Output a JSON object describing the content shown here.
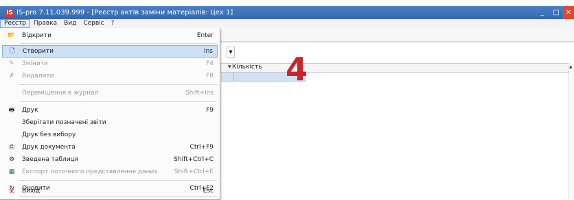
{
  "window": {
    "logo_letter": "IS",
    "title": "IS-pro 7.11.039.999 - [Реєстр актів заміни матеріалів: Цех 1]",
    "minimize": "_",
    "maximize": "□"
  },
  "menubar": [
    "Реєстр",
    "Правка",
    "Вид",
    "Сервіс",
    "?"
  ],
  "menu": {
    "items": [
      {
        "label": "Відкрити",
        "shortcut": "Enter"
      },
      {
        "label": "Створити",
        "shortcut": "Ins"
      },
      {
        "label": "Змінити",
        "shortcut": "F4"
      },
      {
        "label": "Видалити",
        "shortcut": "F8"
      },
      {
        "label": "Переміщення в журнал",
        "shortcut": "Shift+Ins"
      },
      {
        "label": "Друк",
        "shortcut": "F9"
      },
      {
        "label": "Зберігати позначені звіти",
        "shortcut": ""
      },
      {
        "label": "Друк без вибору",
        "shortcut": ""
      },
      {
        "label": "Друк документа",
        "shortcut": "Ctrl+F9"
      },
      {
        "label": "Зведена таблиця",
        "shortcut": "Shift+Ctrl+C"
      },
      {
        "label": "Експорт поточного представлення даних",
        "shortcut": "Shift+Ctrl+E"
      },
      {
        "label": "Оновити",
        "shortcut": "Ctrl+F2"
      },
      {
        "label": "Вихід",
        "shortcut": "Esc"
      }
    ]
  },
  "grid": {
    "column_quantity": "Кількість"
  },
  "annotation": "4"
}
